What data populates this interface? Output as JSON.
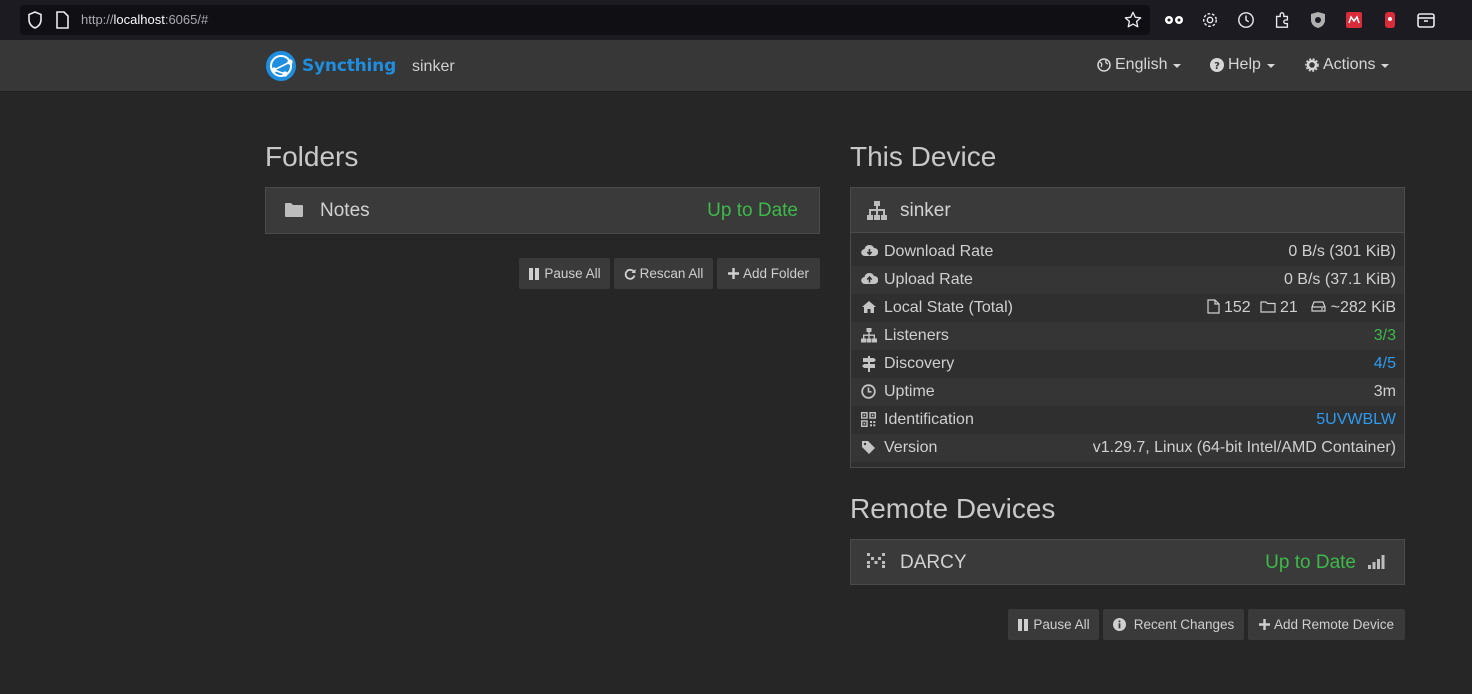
{
  "browser": {
    "url_prefix": "http://",
    "url_host": "localhost",
    "url_rest": ":6065/#"
  },
  "navbar": {
    "brand": "Syncthing",
    "device_name": "sinker",
    "language_label": "English",
    "help_label": "Help",
    "actions_label": "Actions"
  },
  "folders": {
    "title": "Folders",
    "items": [
      {
        "name": "Notes",
        "status": "Up to Date"
      }
    ],
    "buttons": {
      "pause_all": "Pause All",
      "rescan_all": "Rescan All",
      "add_folder": "Add Folder"
    }
  },
  "this_device": {
    "title": "This Device",
    "name": "sinker",
    "rows": {
      "download_rate": {
        "label": "Download Rate",
        "value": "0 B/s (301 KiB)"
      },
      "upload_rate": {
        "label": "Upload Rate",
        "value": "0 B/s (37.1 KiB)"
      },
      "local_state": {
        "label": "Local State (Total)",
        "files": "152",
        "dirs": "21",
        "size": "~282 KiB"
      },
      "listeners": {
        "label": "Listeners",
        "value": "3/3"
      },
      "discovery": {
        "label": "Discovery",
        "value": "4/5"
      },
      "uptime": {
        "label": "Uptime",
        "value": "3m"
      },
      "identification": {
        "label": "Identification",
        "value": "5UVWBLW"
      },
      "version": {
        "label": "Version",
        "value": "v1.29.7, Linux (64-bit Intel/AMD Container)"
      }
    }
  },
  "remote_devices": {
    "title": "Remote Devices",
    "items": [
      {
        "name": "DARCY",
        "status": "Up to Date"
      }
    ],
    "buttons": {
      "pause_all": "Pause All",
      "recent_changes": "Recent Changes",
      "add_remote_device": "Add Remote Device"
    }
  },
  "colors": {
    "accent": "#1e8ee0",
    "ok": "#3db94a",
    "link": "#2d9bf0",
    "background": "#262626",
    "panel": "#2f2f2f"
  }
}
